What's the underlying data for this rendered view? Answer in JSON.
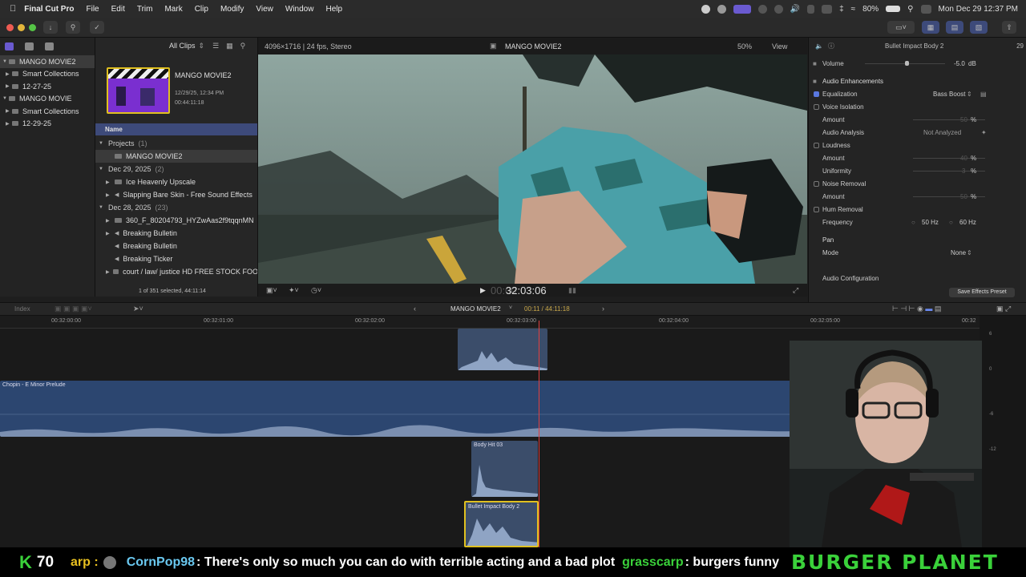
{
  "menubar": {
    "app": "Final Cut Pro",
    "items": [
      "File",
      "Edit",
      "Trim",
      "Mark",
      "Clip",
      "Modify",
      "View",
      "Window",
      "Help"
    ],
    "battery": "80%",
    "datetime": "Mon Dec 29  12:37 PM"
  },
  "libraries": {
    "rows": [
      {
        "label": "MANGO MOVIE2",
        "selected": true
      },
      {
        "label": "Smart Collections"
      },
      {
        "label": "12-27-25"
      },
      {
        "label": "MANGO MOVIE"
      },
      {
        "label": "Smart Collections"
      },
      {
        "label": "12-29-25"
      }
    ]
  },
  "browser": {
    "filter": "All Clips",
    "project_title": "MANGO MOVIE2",
    "project_date": "12/29/25, 12:34 PM",
    "project_duration": "00:44:11:18",
    "column_name": "Name",
    "rows": [
      {
        "kind": "group",
        "label": "Projects",
        "count": "(1)"
      },
      {
        "kind": "item",
        "label": "MANGO MOVIE2",
        "selected": true
      },
      {
        "kind": "group",
        "label": "Dec 29, 2025",
        "count": "(2)"
      },
      {
        "kind": "item",
        "label": "Ice Heavenly Upscale"
      },
      {
        "kind": "item",
        "label": "Slapping Bare Skin - Free Sound Effects"
      },
      {
        "kind": "group",
        "label": "Dec 28, 2025",
        "count": "(23)"
      },
      {
        "kind": "item",
        "label": "360_F_80204793_HYZwAas2f9tqqnMN"
      },
      {
        "kind": "item",
        "label": "Breaking Bulletin"
      },
      {
        "kind": "item",
        "label": "Breaking Bulletin"
      },
      {
        "kind": "item",
        "label": "Breaking Ticker"
      },
      {
        "kind": "item",
        "label": "court / law/ justice HD FREE STOCK FOO"
      }
    ],
    "status": "1 of 351 selected, 44:11:14"
  },
  "viewer": {
    "format": "4096×1716 | 24 fps, Stereo",
    "title": "MANGO MOVIE2",
    "zoom": "50%",
    "view": "View",
    "timecode": "32:03:06",
    "timecode_prefix": "00:00"
  },
  "inspector": {
    "clip_name": "Bullet Impact Body 2",
    "clip_time": "29",
    "volume_label": "Volume",
    "volume_value": "-5.0",
    "volume_unit": "dB",
    "section": "Audio Enhancements",
    "equalization": "Equalization",
    "eq_preset": "Bass Boost",
    "voice_isolation": "Voice Isolation",
    "amount": "Amount",
    "amount_voice": "50",
    "audio_analysis": "Audio Analysis",
    "not_analyzed": "Not Analyzed",
    "loudness": "Loudness",
    "amount_loud": "40",
    "uniformity": "Uniformity",
    "uniformity_val": "3",
    "noise_removal": "Noise Removal",
    "amount_noise": "50",
    "hum_removal": "Hum Removal",
    "frequency": "Frequency",
    "hz50": "50 Hz",
    "hz60": "60 Hz",
    "pan": "Pan",
    "mode": "Mode",
    "mode_val": "None",
    "audio_config": "Audio Configuration",
    "save_preset": "Save Effects Preset",
    "percent": "%"
  },
  "timeline": {
    "index": "Index",
    "project": "MANGO MOVIE2",
    "position": "00:11 / 44:11:18",
    "ticks": [
      "00:32:00:00",
      "00:32:01:00",
      "00:32:02:00",
      "00:32:03:00",
      "00:32:04:00",
      "00:32:05:00",
      "00:32"
    ],
    "clips": {
      "music": "Chopin - E Minor Prelude",
      "body_hit": "Body Hit 03",
      "bullet": "Bullet Impact Body 2"
    },
    "meter_labels": [
      "6",
      "0",
      "-6",
      "-12"
    ]
  },
  "chat": {
    "count": "70",
    "user1": "arp :",
    "user2": "CornPop98",
    "msg2": ": There's only so much you can do with terrible acting and a bad plot",
    "user3": "grasscarp",
    "msg3": ": burgers funny",
    "brand": "BURGER PLANET"
  },
  "colors": {
    "accent": "#5a78e0",
    "playhead": "#e04040",
    "clip_blue": "#2d4a7a",
    "clip_selected": "#e0c020",
    "chat_green": "#3ad13a"
  }
}
